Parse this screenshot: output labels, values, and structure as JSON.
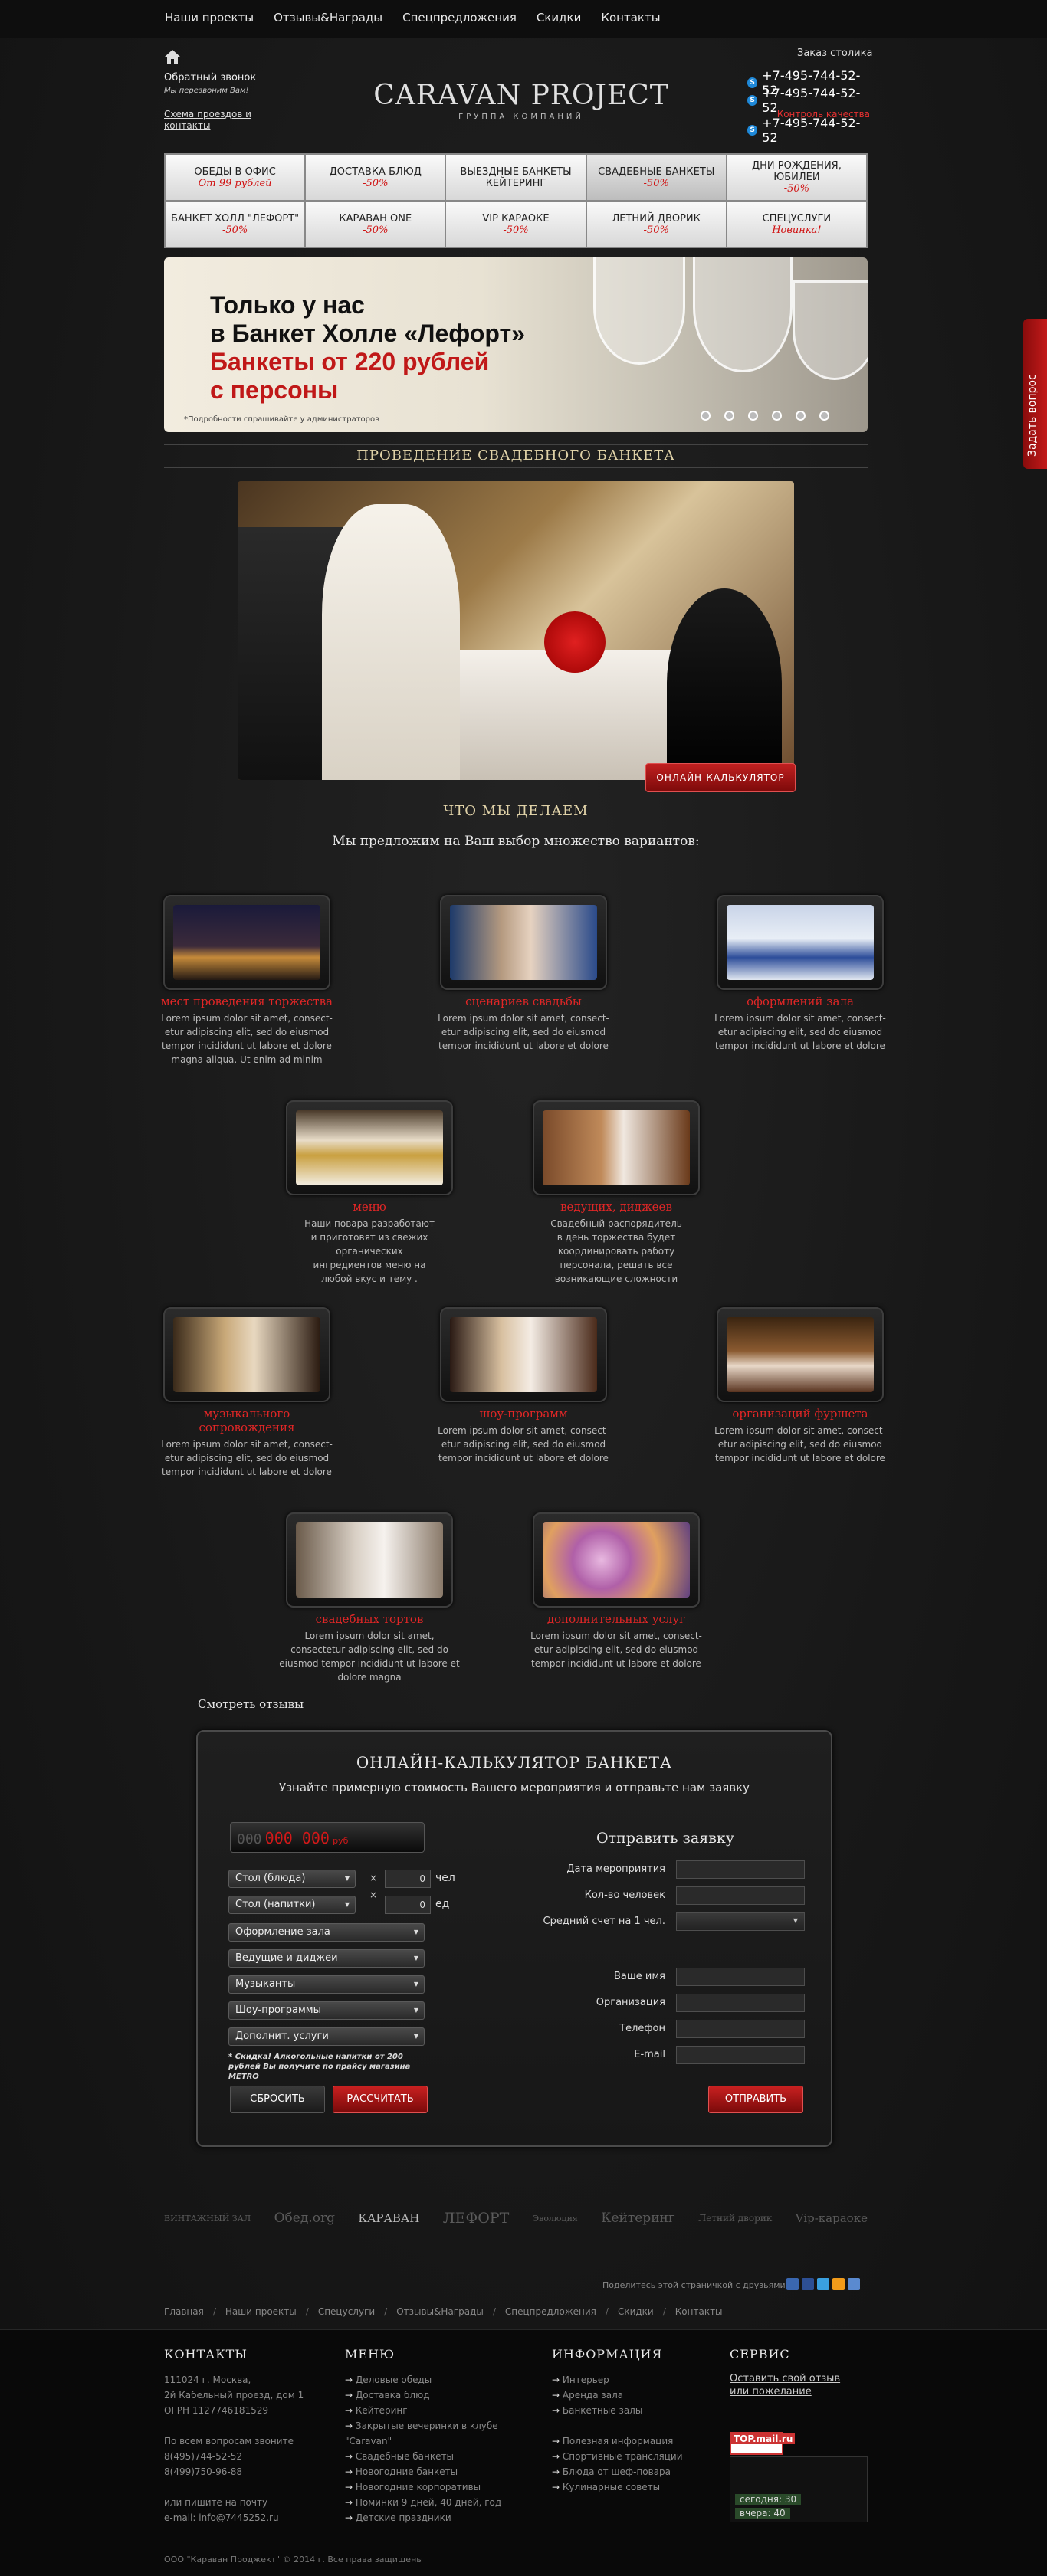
{
  "nav": [
    "Наши проекты",
    "Отзывы&Награды",
    "Спецпредложения",
    "Скидки",
    "Контакты"
  ],
  "callback": {
    "title": "Обратный звонок",
    "subtitle": "Мы перезвоним Вам!",
    "scheme": "Схема проездов и контакты"
  },
  "logo": {
    "name": "CARAVAN PROJECT",
    "tagline": "ГРУППА КОМПАНИЙ"
  },
  "order_link": "Заказ столика",
  "phones": [
    "+7-495-744-52-52",
    "+7-495-744-52-52",
    "+7-495-744-52-52"
  ],
  "quality": "Контроль качества",
  "menu": [
    {
      "a": "ОБЕДЫ В ОФИС",
      "b": "От 99 рублей"
    },
    {
      "a": "ДОСТАВКА БЛЮД",
      "b": "-50%"
    },
    {
      "a": "ВЫЕЗДНЫЕ БАНКЕТЫ КЕЙТЕРИНГ",
      "b": ""
    },
    {
      "a": "СВАДЕБНЫЕ БАНКЕТЫ",
      "b": "-50%"
    },
    {
      "a": "ДНИ РОЖДЕНИЯ, ЮБИЛЕИ",
      "b": "-50%"
    },
    {
      "a": "БАНКЕТ ХОЛЛ \"ЛЕФОРТ\"",
      "b": "-50%"
    },
    {
      "a": "КАРАВАН ONE",
      "b": "-50%"
    },
    {
      "a": "VIP КАРАОКЕ",
      "b": "-50%"
    },
    {
      "a": "ЛЕТНИЙ ДВОРИК",
      "b": "-50%"
    },
    {
      "a": "СПЕЦУСЛУГИ",
      "b": "Новинка!"
    }
  ],
  "banner": {
    "l1": "Только у нас",
    "l2": "в Банкет Холле «Лефорт»",
    "l3": "Банкеты от 220 рублей",
    "l4": "с персоны",
    "note": "*Подробности спрашивайте у администраторов"
  },
  "section_title": "ПРОВЕДЕНИЕ СВАДЕБНОГО БАНКЕТА",
  "calc_button": "ОНЛАЙН-КАЛЬКУЛЯТОР",
  "what_title": "ЧТО МЫ ДЕЛАЕМ",
  "what_sub": "Мы предложим на Ваш выбор множество вариантов:",
  "cards": [
    {
      "t": "мест проведения торжества",
      "d": "Lorem ipsum dolor sit amet, consect-etur adipiscing elit, sed do eiusmod tempor incididunt ut labore et dolore magna aliqua. Ut enim ad minim"
    },
    {
      "t": "сценариев свадьбы",
      "d": "Lorem ipsum dolor sit amet, consect-etur adipiscing elit, sed do eiusmod tempor incididunt ut labore et dolore"
    },
    {
      "t": "оформлений зала",
      "d": "Lorem ipsum dolor sit amet, consect-etur adipiscing elit, sed do eiusmod tempor incididunt ut labore et dolore"
    },
    {
      "t": "меню",
      "d": "Наши повара разработают и приготовят из свежих органических ингредиентов меню на любой вкус и тему ."
    },
    {
      "t": "ведущих, диджеев",
      "d": "Свадебный распорядитель в день торжества будет координировать работу персонала, решать все возникающие сложности"
    },
    {
      "t": "музыкального сопровождения",
      "d": "Lorem ipsum dolor sit amet, consect-etur adipiscing elit, sed do eiusmod tempor incididunt ut labore et dolore"
    },
    {
      "t": "шоу-программ",
      "d": "Lorem ipsum dolor sit amet, consect-etur adipiscing elit, sed do eiusmod tempor incididunt ut labore et dolore"
    },
    {
      "t": "организаций фуршета",
      "d": "Lorem ipsum dolor sit amet, consect-etur adipiscing elit, sed do eiusmod tempor incididunt ut labore et dolore"
    },
    {
      "t": "свадебных тортов",
      "d": "Lorem ipsum dolor sit amet, consectetur adipiscing elit, sed do eiusmod tempor incididunt ut labore et dolore magna"
    },
    {
      "t": "дополнительных услуг",
      "d": "Lorem ipsum dolor sit amet, consect-etur adipiscing elit, sed do eiusmod tempor incididunt ut labore et dolore"
    }
  ],
  "reviews": "Смотреть отзывы",
  "calc": {
    "title": "ОНЛАЙН-КАЛЬКУЛЯТОР БАНКЕТА",
    "subtitle": "Узнайте примерную стоимость Вашего мероприятия и отправьте нам заявку",
    "display_zero": "000",
    "display_value": "000 000",
    "display_unit": "руб",
    "selects": [
      "Стол (блюда)",
      "Стол (напитки)",
      "Оформление зала",
      "Ведущие и диджеи",
      "Музыканты",
      "Шоу-программы",
      "Дополнит. услуги"
    ],
    "qty1": "0",
    "unit1": "чел",
    "qty2": "0",
    "unit2": "ед",
    "times": "×",
    "note": "* Скидка! Алкогольные напитки от 200 рублей Вы получите по прайсу магазина METRO",
    "reset": "СБРОСИТЬ",
    "calculate": "РАССЧИТАТЬ",
    "form_title": "Отправить заявку",
    "fields": [
      "Дата мероприятия",
      "Кол-во человек",
      "Средний счет на 1 чел.",
      "Ваше имя",
      "Организация",
      "Телефон",
      "E-mail"
    ],
    "send": "ОТПРАВИТЬ"
  },
  "partners": [
    "ВИНТАЖНЫЙ ЗАЛ",
    "Обед.org",
    "КАРАВАН",
    "ЛЕФОРТ",
    "Эволюция",
    "Кейтеринг",
    "Летний дворик",
    "Vip-караоке"
  ],
  "share": "Поделитесь этой страничкой с друзьями!",
  "crumbs": [
    "Главная",
    "Наши проекты",
    "Спецуслуги",
    "Отзывы&Награды",
    "Спецпредложения",
    "Скидки",
    "Контакты"
  ],
  "footer": {
    "contacts_h": "КОНТАКТЫ",
    "contacts": [
      "111024 г. Москва,",
      "2й Кабельный проезд, дом 1",
      "ОГРН 1127746181529",
      "",
      "По всем вопросам звоните",
      "8(495)744-52-52",
      "8(499)750-96-88",
      "",
      "или пишите на почту",
      "e-mail: info@7445252.ru"
    ],
    "menu_h": "МЕНЮ",
    "menu": [
      "Деловые обеды",
      "Доставка блюд",
      "Кейтеринг",
      "Закрытые вечеринки в клубе \"Caravan\"",
      "Свадебные банкеты",
      "Новогодние банкеты",
      "Новогодние корпоративы",
      "Поминки 9 дней, 40 дней, год",
      "Детские праздники"
    ],
    "info_h": "ИНФОРМАЦИЯ",
    "info": [
      "Интерьер",
      "Аренда зала",
      "Банкетные залы",
      "",
      "Полезная информация",
      "Спортивные трансляции",
      "Блюда от шеф-повара",
      "Кулинарные советы"
    ],
    "service_h": "СЕРВИС",
    "service": "Оставить свой отзыв или пожелание",
    "counter": "TOP.mail.ru",
    "today": "сегодня: 30",
    "yesterday": "вчера: 40",
    "copy": "ООО \"Караван Проджект\" © 2014 г. Все права защищены"
  },
  "ask": "Задать вопрос"
}
